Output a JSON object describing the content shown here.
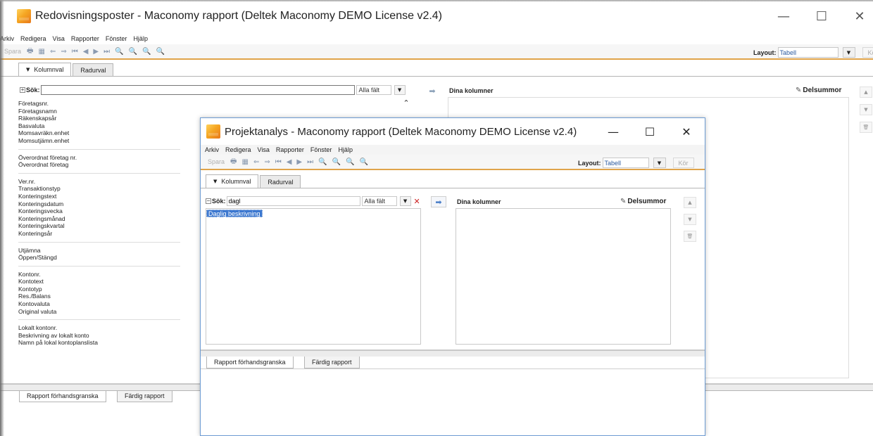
{
  "back_window": {
    "title": "Redovisningsposter - Maconomy rapport (Deltek Maconomy DEMO License v2.4)",
    "controls": {
      "minimize": "—",
      "maximize": "☐",
      "close": "✕"
    },
    "menu": [
      "Arkiv",
      "Redigera",
      "Visa",
      "Rapporter",
      "Fönster",
      "Hjälp"
    ],
    "toolbar": {
      "save_label": "Spara",
      "icons": [
        "print-icon",
        "calendar-icon",
        "back-icon",
        "forward-icon",
        "first-icon",
        "prev-icon",
        "next-icon",
        "last-icon",
        "zoom-icon",
        "zoom-in-icon",
        "zoom-out-icon",
        "fit-icon"
      ],
      "layout_label": "Layout:",
      "layout_value": "Tabell",
      "run_label": "Kör"
    },
    "tabs": [
      "Kolumnval",
      "Radurval"
    ],
    "search": {
      "label": "Sök:",
      "value": "",
      "field_scope": "Alla fält"
    },
    "dina_kolumner": "Dina kolumner",
    "delsummor": "Delsummor",
    "field_groups": [
      [
        "Företagsnr.",
        "Företagsnamn",
        "Räkenskapsår",
        "Basvaluta",
        "Momsavräkn.enhet",
        "Momsutjämn.enhet"
      ],
      [
        "Överordnat företag nr.",
        "Överordnat företag"
      ],
      [
        "Ver.nr.",
        "Transaktionstyp",
        "Konteringstext",
        "Konteringsdatum",
        "Konteringsvecka",
        "Konteringsmånad",
        "Konteringskvartal",
        "Konteringsår"
      ],
      [
        "Utjämna",
        "Öppen/Stängd"
      ],
      [
        "Kontonr.",
        "Kontotext",
        "Kontotyp",
        "Res./Balans",
        "Kontovaluta",
        "Original valuta"
      ],
      [
        "Lokalt kontonr.",
        "Beskrivning av lokalt konto",
        "Namn på lokal kontoplanslista"
      ]
    ],
    "bottom_tabs": [
      "Rapport förhandsgranska",
      "Färdig rapport"
    ]
  },
  "front_window": {
    "title": "Projektanalys - Maconomy rapport (Deltek Maconomy DEMO License v2.4)",
    "controls": {
      "minimize": "—",
      "maximize": "☐",
      "close": "✕"
    },
    "menu": [
      "Arkiv",
      "Redigera",
      "Visa",
      "Rapporter",
      "Fönster",
      "Hjälp"
    ],
    "toolbar": {
      "save_label": "Spara",
      "layout_label": "Layout:",
      "layout_value": "Tabell",
      "run_label": "Kör"
    },
    "tabs": [
      "Kolumnval",
      "Radurval"
    ],
    "search": {
      "label": "Sök:",
      "value": "dagl",
      "field_scope": "Alla fält"
    },
    "results": [
      "Daglig beskrivning"
    ],
    "dina_kolumner": "Dina kolumner",
    "delsummor": "Delsummor",
    "bottom_tabs": [
      "Rapport förhandsgranska",
      "Färdig rapport"
    ]
  },
  "glyphs": {
    "print": "🖶",
    "calendar": "▦",
    "back": "⇐",
    "forward": "⇒",
    "first": "⏮",
    "prev": "◀",
    "next": "▶",
    "last": "⏭",
    "zoom": "🔍",
    "move_right": "➡",
    "up": "▲",
    "down": "▼",
    "trash": "🗑",
    "caret_down": "▼",
    "pen": "✎",
    "clear": "✕",
    "scroll_up": "⌃"
  }
}
